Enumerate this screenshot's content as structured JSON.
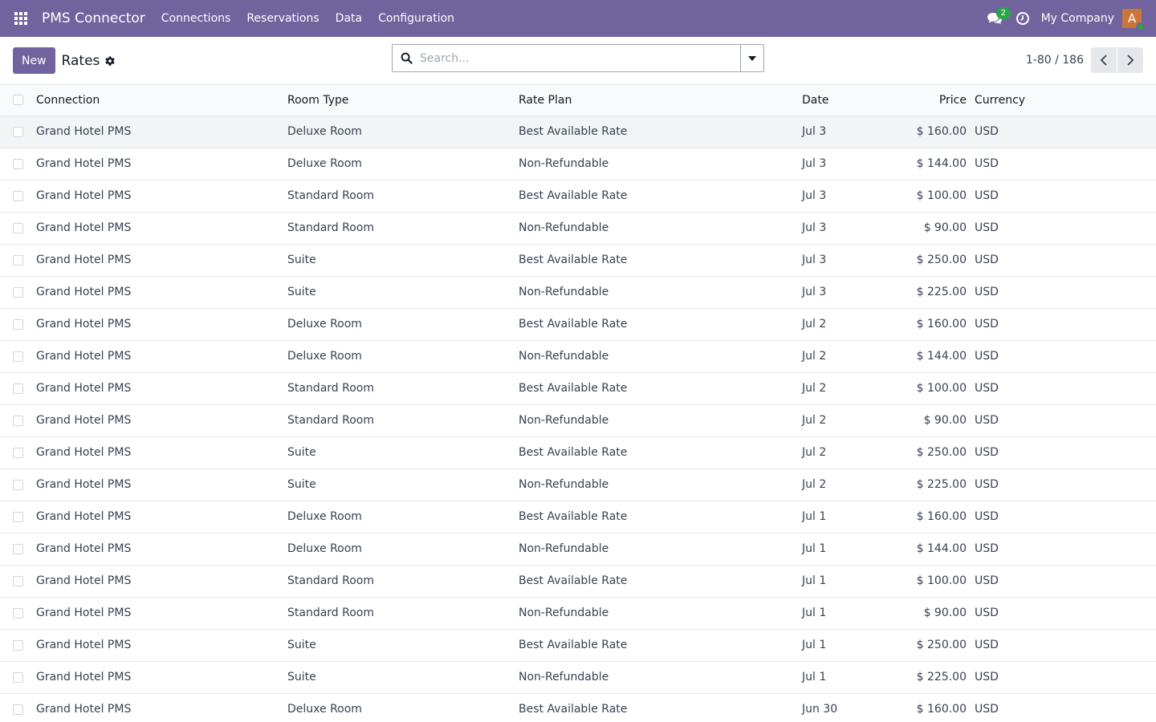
{
  "app": {
    "brand": "PMS Connector",
    "menu": [
      "Connections",
      "Reservations",
      "Data",
      "Configuration"
    ],
    "messages_count": "2",
    "company": "My Company",
    "avatar_letter": "A",
    "colors": {
      "navbar": "#71639e",
      "avatar": "#c97639",
      "badge": "#28a745"
    }
  },
  "control": {
    "new_label": "New",
    "title": "Rates",
    "search_placeholder": "Search...",
    "pager": "1-80 / 186"
  },
  "table": {
    "columns": [
      "Connection",
      "Room Type",
      "Rate Plan",
      "Date",
      "Price",
      "Currency"
    ],
    "rows": [
      [
        "Grand Hotel PMS",
        "Deluxe Room",
        "Best Available Rate",
        "Jul 3",
        "$ 160.00",
        "USD"
      ],
      [
        "Grand Hotel PMS",
        "Deluxe Room",
        "Non-Refundable",
        "Jul 3",
        "$ 144.00",
        "USD"
      ],
      [
        "Grand Hotel PMS",
        "Standard Room",
        "Best Available Rate",
        "Jul 3",
        "$ 100.00",
        "USD"
      ],
      [
        "Grand Hotel PMS",
        "Standard Room",
        "Non-Refundable",
        "Jul 3",
        "$ 90.00",
        "USD"
      ],
      [
        "Grand Hotel PMS",
        "Suite",
        "Best Available Rate",
        "Jul 3",
        "$ 250.00",
        "USD"
      ],
      [
        "Grand Hotel PMS",
        "Suite",
        "Non-Refundable",
        "Jul 3",
        "$ 225.00",
        "USD"
      ],
      [
        "Grand Hotel PMS",
        "Deluxe Room",
        "Best Available Rate",
        "Jul 2",
        "$ 160.00",
        "USD"
      ],
      [
        "Grand Hotel PMS",
        "Deluxe Room",
        "Non-Refundable",
        "Jul 2",
        "$ 144.00",
        "USD"
      ],
      [
        "Grand Hotel PMS",
        "Standard Room",
        "Best Available Rate",
        "Jul 2",
        "$ 100.00",
        "USD"
      ],
      [
        "Grand Hotel PMS",
        "Standard Room",
        "Non-Refundable",
        "Jul 2",
        "$ 90.00",
        "USD"
      ],
      [
        "Grand Hotel PMS",
        "Suite",
        "Best Available Rate",
        "Jul 2",
        "$ 250.00",
        "USD"
      ],
      [
        "Grand Hotel PMS",
        "Suite",
        "Non-Refundable",
        "Jul 2",
        "$ 225.00",
        "USD"
      ],
      [
        "Grand Hotel PMS",
        "Deluxe Room",
        "Best Available Rate",
        "Jul 1",
        "$ 160.00",
        "USD"
      ],
      [
        "Grand Hotel PMS",
        "Deluxe Room",
        "Non-Refundable",
        "Jul 1",
        "$ 144.00",
        "USD"
      ],
      [
        "Grand Hotel PMS",
        "Standard Room",
        "Best Available Rate",
        "Jul 1",
        "$ 100.00",
        "USD"
      ],
      [
        "Grand Hotel PMS",
        "Standard Room",
        "Non-Refundable",
        "Jul 1",
        "$ 90.00",
        "USD"
      ],
      [
        "Grand Hotel PMS",
        "Suite",
        "Best Available Rate",
        "Jul 1",
        "$ 250.00",
        "USD"
      ],
      [
        "Grand Hotel PMS",
        "Suite",
        "Non-Refundable",
        "Jul 1",
        "$ 225.00",
        "USD"
      ],
      [
        "Grand Hotel PMS",
        "Deluxe Room",
        "Best Available Rate",
        "Jun 30",
        "$ 160.00",
        "USD"
      ]
    ]
  }
}
